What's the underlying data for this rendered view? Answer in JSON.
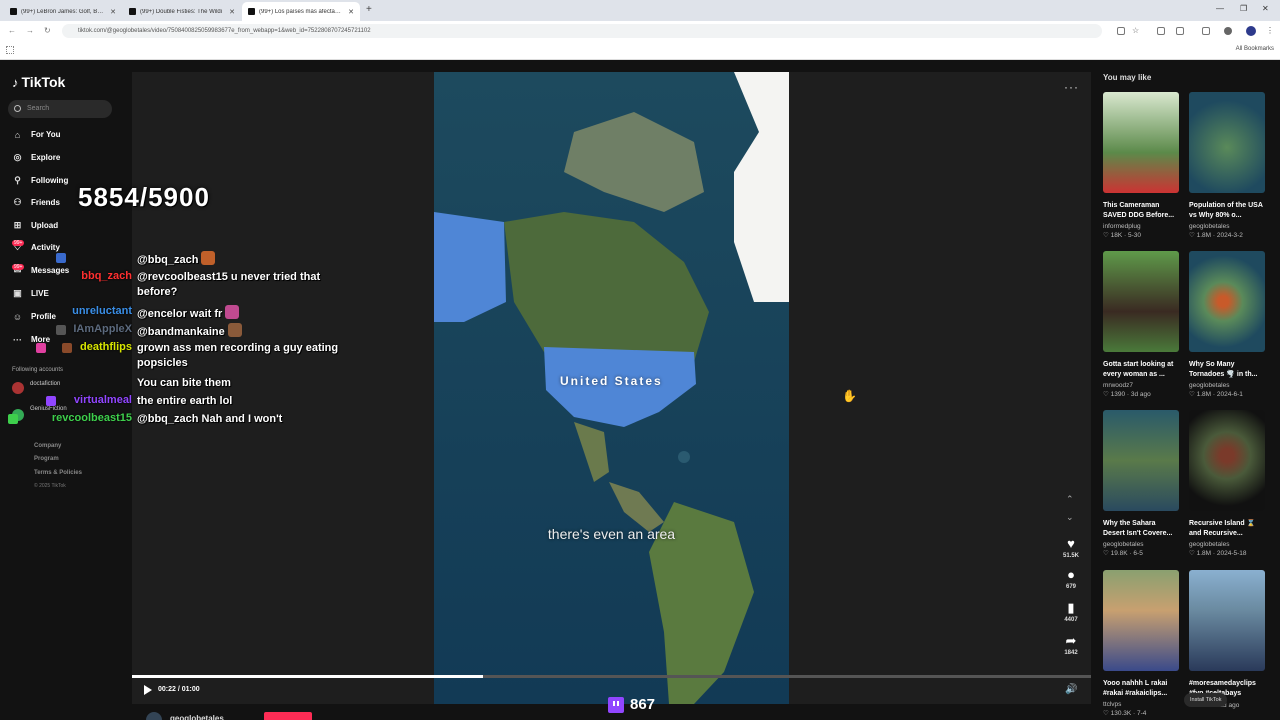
{
  "browser": {
    "tabs": [
      {
        "title": "(99+) LeBron James: Golf, Barto"
      },
      {
        "title": "(99+) Double Fisties: The Wildi"
      },
      {
        "title": "(99+) Los países más afectados"
      }
    ],
    "url": "tiktok.com/@geoglobetales/video/7508400825059983677e_from_webapp=1&web_id=7522808707245721102",
    "all_bookmarks": "All Bookmarks"
  },
  "sidebar": {
    "logo": "TikTok",
    "search_placeholder": "Search",
    "nav": [
      {
        "label": "For You",
        "icon": "home-icon"
      },
      {
        "label": "Explore",
        "icon": "compass-icon"
      },
      {
        "label": "Following",
        "icon": "following-icon"
      },
      {
        "label": "Friends",
        "icon": "friends-icon"
      },
      {
        "label": "Upload",
        "icon": "upload-icon"
      },
      {
        "label": "Activity",
        "icon": "activity-icon",
        "badge": "99+"
      },
      {
        "label": "Messages",
        "icon": "messages-icon",
        "badge": "99+"
      },
      {
        "label": "LIVE",
        "icon": "live-icon"
      },
      {
        "label": "Profile",
        "icon": "profile-icon"
      },
      {
        "label": "More",
        "icon": "more-icon"
      }
    ],
    "following_title": "Following accounts",
    "following_accounts": [
      "doctafiction",
      "GeniusFiction"
    ],
    "footer": [
      "Company",
      "Program",
      "Terms & Policies"
    ],
    "copyright": "© 2025 TikTok"
  },
  "player": {
    "caption": "there's even an area",
    "map_label": "United States",
    "time": "00:22 / 01:00",
    "progress": 0.366,
    "author": "geoglobetales",
    "actions": [
      {
        "icon": "heart-icon",
        "count": "51.5K"
      },
      {
        "icon": "comment-icon",
        "count": "679"
      },
      {
        "icon": "bookmark-icon",
        "count": "4407"
      },
      {
        "icon": "share-icon",
        "count": "1842"
      }
    ]
  },
  "overlay": {
    "counter": "5854/5900",
    "viewers": "867",
    "chat": [
      {
        "user": "",
        "message": "@bbq_zach",
        "user_color": "#ffffff"
      },
      {
        "user": "bbq_zach",
        "message": "@revcoolbeast15 u never tried that before?",
        "user_color": "#ff3030"
      },
      {
        "user": "unreluctant",
        "message": "@encelor wait fr",
        "user_color": "#3a8ee6"
      },
      {
        "user": "IAmAppleX",
        "message": "@bandmankaine",
        "user_color": "#5c6a7e"
      },
      {
        "user": "deathflips",
        "message": "grown ass men recording a guy eating popsicles",
        "user_color": "#d8e600"
      },
      {
        "user": "",
        "message": "You can bite them",
        "user_color": "#ffffff"
      },
      {
        "user": "virtualmeal",
        "message": "the entire earth lol",
        "user_color": "#9146ff"
      },
      {
        "user": "revcoolbeast15",
        "message": "@bbq_zach Nah and I won't",
        "user_color": "#3ecf4c"
      }
    ]
  },
  "rail": {
    "title": "You may like",
    "cards": [
      {
        "title": "This Cameraman SAVED DDG Before...",
        "author": "informedplug",
        "likes": "18K",
        "date": "5-30"
      },
      {
        "title": "Population of the USA vs Why 80% o...",
        "author": "geoglobetales",
        "likes": "1.8M",
        "date": "2024-3-2"
      },
      {
        "title": "Gotta start looking at every woman as ...",
        "author": "mrwoodz7",
        "likes": "1390",
        "date": "3d ago"
      },
      {
        "title": "Why So Many Tornadoes 🌪️ in th...",
        "author": "geoglobetales",
        "likes": "1.8M",
        "date": "2024-6-1"
      },
      {
        "title": "Why the Sahara Desert Isn't Covere...",
        "author": "geoglobetales",
        "likes": "19.8K",
        "date": "6-5"
      },
      {
        "title": "Recursive Island ⌛ and Recursive...",
        "author": "geoglobetales",
        "likes": "1.8M",
        "date": "2024-5-18"
      },
      {
        "title": "Yooo nahhh L rakai #rakai #rakaiclips...",
        "author": "ttclvps",
        "likes": "130.3K",
        "date": "7-4"
      },
      {
        "title": "#moresamedayclips #fyp #celtabays",
        "author": "",
        "likes": "28.5K",
        "date": "2d ago"
      }
    ],
    "install": "Install TikTok"
  }
}
